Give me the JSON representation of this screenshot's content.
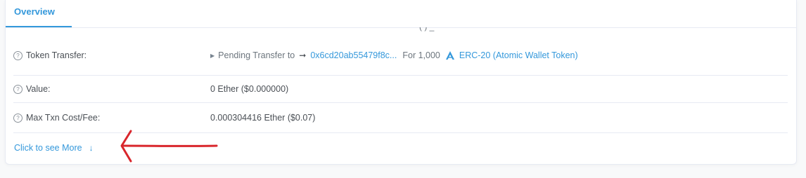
{
  "tabs": [
    {
      "label": "Overview",
      "active": true
    }
  ],
  "rows": [
    {
      "label": "Token Transfer:",
      "pending_text": "Pending Transfer to",
      "to_address": "0x6cd20ab55479f8c...",
      "for_text": "For 1,000",
      "token_name": "ERC-20 (Atomic Wallet Token)"
    },
    {
      "label": "Value:",
      "value": "0 Ether ($0.000000)"
    },
    {
      "label": "Max Txn Cost/Fee:",
      "value": "0.000304416 Ether ($0.07)"
    }
  ],
  "more_link": {
    "label": "Click to see More"
  },
  "icons": {
    "help": "question-circle-icon",
    "arrow_right": "long-arrow-right-icon",
    "token": "atomic-wallet-logo-icon",
    "down": "arrow-down-icon",
    "annotation": "red-arrow-annotation"
  },
  "colors": {
    "accent": "#3498db",
    "text": "#4a4f55",
    "border": "#e7eaf3",
    "annotation": "#d9262c"
  }
}
